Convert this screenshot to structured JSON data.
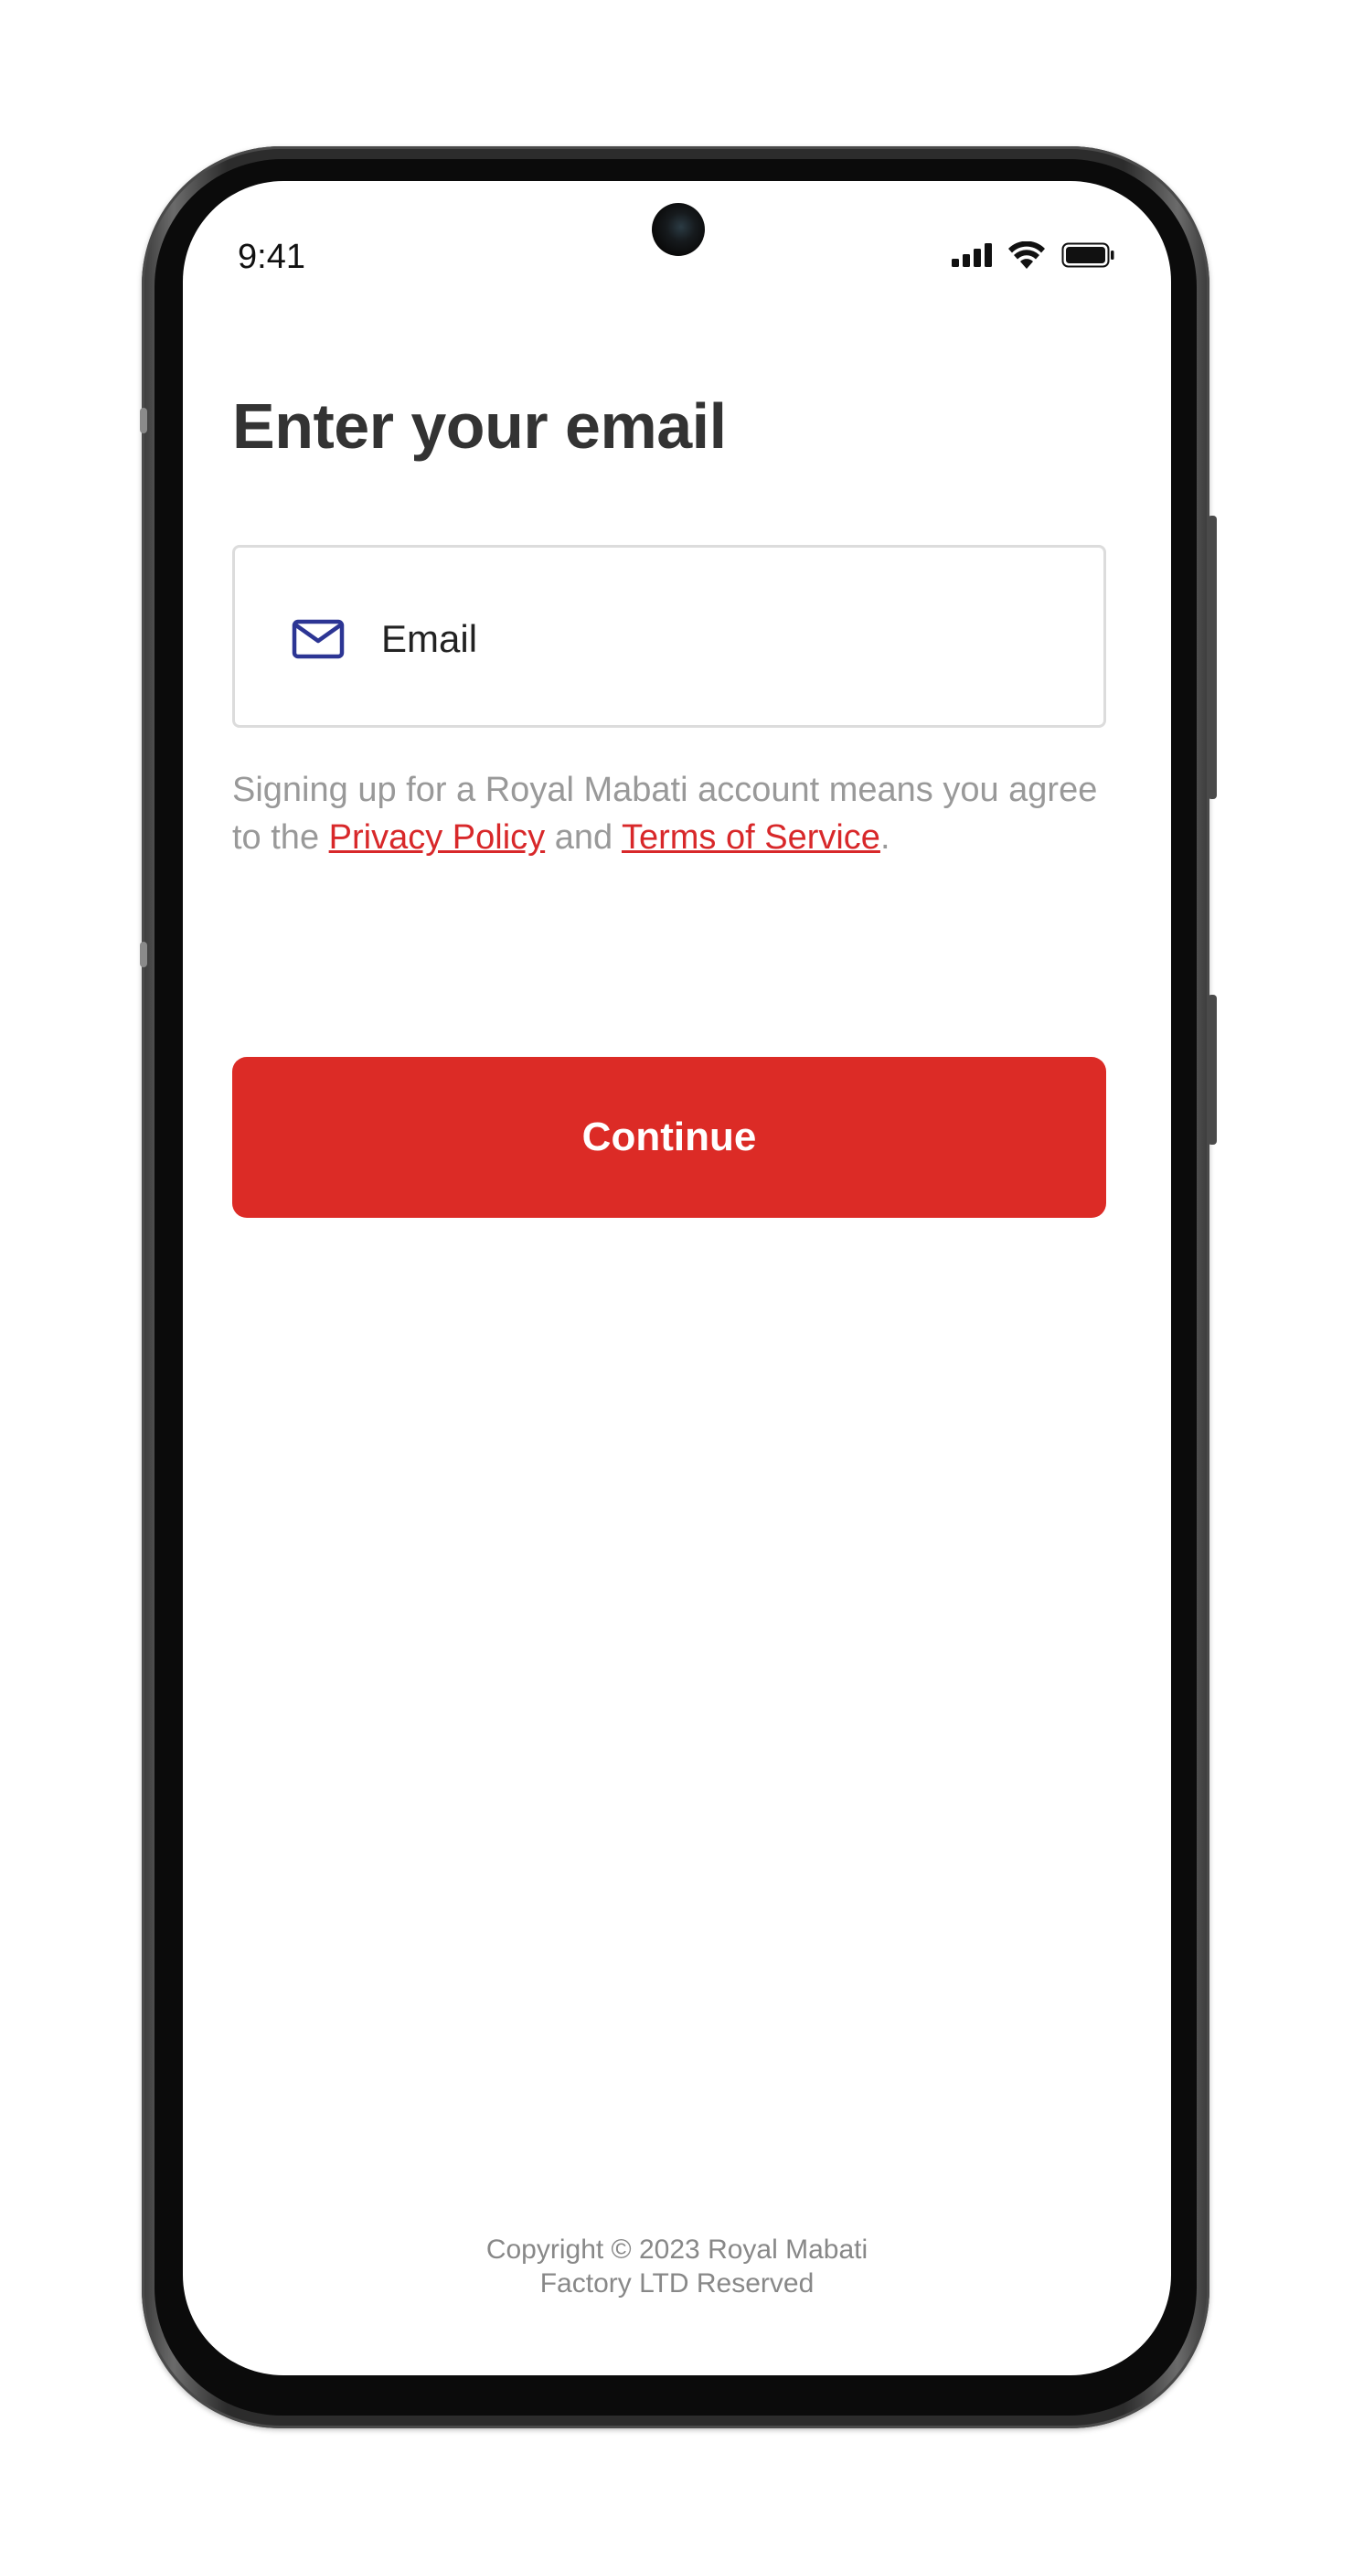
{
  "status_bar": {
    "time": "9:41",
    "icons": [
      "signal-icon",
      "wifi-icon",
      "battery-icon"
    ]
  },
  "screen": {
    "title": "Enter your email",
    "email_field": {
      "icon": "mail-icon",
      "placeholder": "Email",
      "value": ""
    },
    "terms": {
      "prefix": "Signing up for a Royal Mabati account means you agree to the ",
      "privacy_link": "Privacy Policy",
      "middle": " and ",
      "terms_link": "Terms of Service",
      "suffix": "."
    },
    "continue_label": "Continue",
    "copyright": {
      "line1": "Copyright © 2023 Royal Mabati",
      "line2": "Factory LTD Reserved"
    }
  },
  "colors": {
    "primary": "#dc2b26",
    "link": "#d8282a",
    "icon": "#2c3594",
    "title": "#333333",
    "muted_text": "#999999"
  }
}
